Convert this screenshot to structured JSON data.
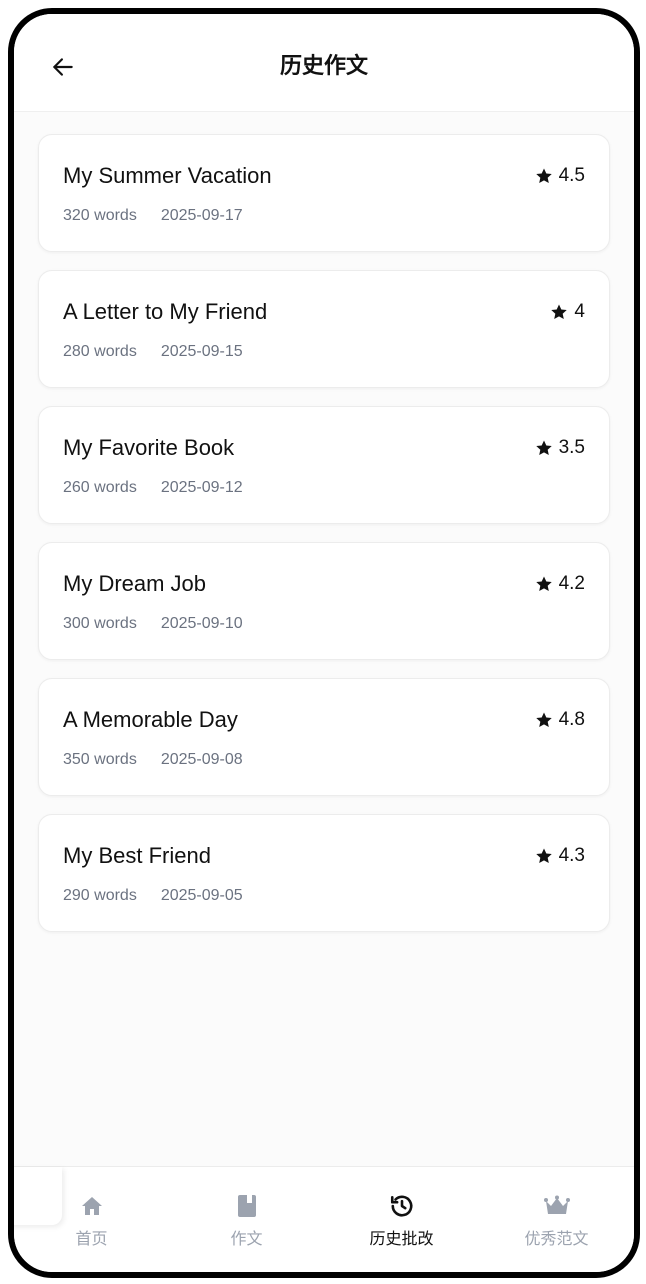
{
  "header": {
    "title": "历史作文",
    "back_icon": "arrow-left-icon"
  },
  "essays": [
    {
      "title": "My Summer Vacation",
      "words": "320 words",
      "date": "2025-09-17",
      "score": "4.5"
    },
    {
      "title": "A Letter to My Friend",
      "words": "280 words",
      "date": "2025-09-15",
      "score": "4"
    },
    {
      "title": "My Favorite Book",
      "words": "260 words",
      "date": "2025-09-12",
      "score": "3.5"
    },
    {
      "title": "My Dream Job",
      "words": "300 words",
      "date": "2025-09-10",
      "score": "4.2"
    },
    {
      "title": "A Memorable Day",
      "words": "350 words",
      "date": "2025-09-08",
      "score": "4.8"
    },
    {
      "title": "My Best Friend",
      "words": "290 words",
      "date": "2025-09-05",
      "score": "4.3"
    }
  ],
  "tabbar": {
    "tabs": [
      {
        "label": "首页",
        "icon": "home-icon",
        "active": false
      },
      {
        "label": "作文",
        "icon": "book-icon",
        "active": false
      },
      {
        "label": "历史批改",
        "icon": "history-icon",
        "active": true
      },
      {
        "label": "优秀范文",
        "icon": "crown-icon",
        "active": false
      }
    ]
  },
  "colors": {
    "active": "#111111",
    "inactive": "#9ca3af",
    "meta": "#6b7280"
  }
}
